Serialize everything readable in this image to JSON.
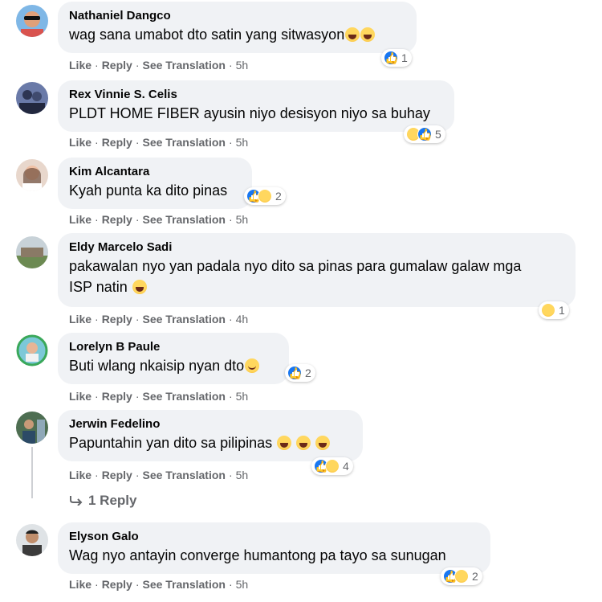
{
  "actions": {
    "like": "Like",
    "reply": "Reply",
    "translate": "See Translation"
  },
  "comments": [
    {
      "author": "Nathaniel Dangco",
      "text": "wag sana umabot dto satin yang sitwasyon",
      "emojis": [
        "laugh",
        "laugh"
      ],
      "time": "5h",
      "reactions": [
        "like"
      ],
      "count": "1"
    },
    {
      "author": "Rex Vinnie S. Celis",
      "text": "PLDT HOME FIBER ayusin niyo desisyon niyo sa buhay",
      "emojis": [],
      "time": "5h",
      "reactions": [
        "haha",
        "like"
      ],
      "count": "5"
    },
    {
      "author": "Kim Alcantara",
      "text": "Kyah punta ka dito pinas",
      "emojis": [],
      "time": "5h",
      "reactions": [
        "like",
        "haha"
      ],
      "count": "2"
    },
    {
      "author": "Eldy Marcelo Sadi",
      "text": "pakawalan nyo yan padala nyo dito sa pinas para gumalaw galaw mga",
      "text2": "ISP natin",
      "emojis": [
        "laugh"
      ],
      "time": "4h",
      "reactions": [
        "haha"
      ],
      "count": "1"
    },
    {
      "author": "Lorelyn B Paule",
      "text": "Buti wlang nkaisip nyan dto",
      "emojis": [
        "smile"
      ],
      "time": "5h",
      "reactions": [
        "like"
      ],
      "count": "2"
    },
    {
      "author": "Jerwin Fedelino",
      "text": "Papuntahin yan dito sa pilipinas ",
      "emojis": [
        "laugh",
        "laugh",
        "laugh"
      ],
      "time": "5h",
      "reactions": [
        "like",
        "haha"
      ],
      "count": "4",
      "replies": "1 Reply"
    },
    {
      "author": "Elyson Galo",
      "text": "Wag nyo antayin converge humantong pa tayo sa sunugan",
      "emojis": [],
      "time": "5h",
      "reactions": [
        "like",
        "haha"
      ],
      "count": "2"
    }
  ]
}
